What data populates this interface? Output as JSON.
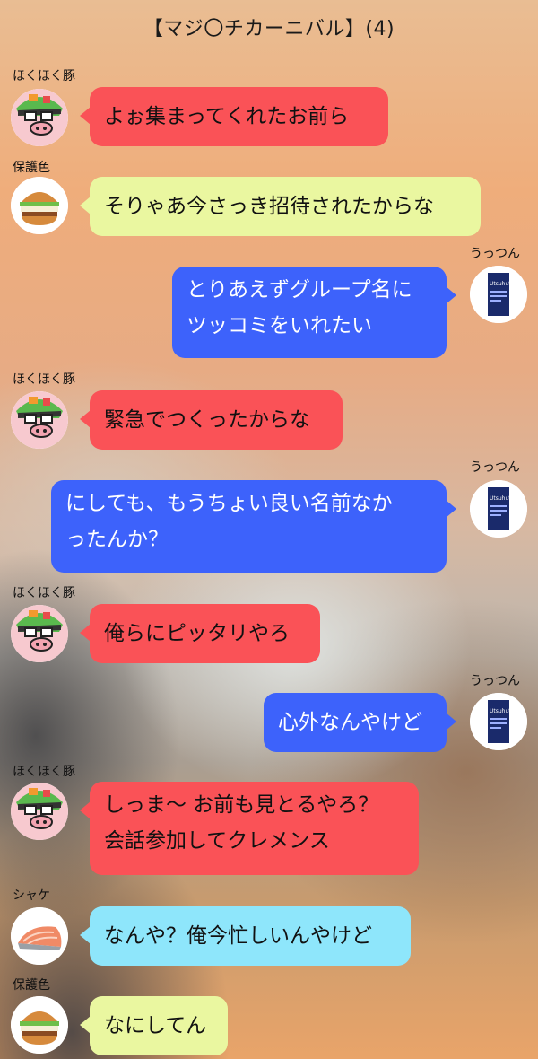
{
  "header": {
    "title": "【マジ〇チカーニバル】(4)"
  },
  "users": {
    "pig": {
      "name": "ほくほく豚",
      "avatar": "pig-avatar-icon"
    },
    "burger": {
      "name": "保護色",
      "avatar": "burger-avatar-icon"
    },
    "book": {
      "name": "うっつん",
      "avatar": "book-cover-avatar-icon"
    },
    "salmon": {
      "name": "シャケ",
      "avatar": "salmon-avatar-icon"
    }
  },
  "messages": [
    {
      "sender": "ほくほく豚",
      "text": "よぉ集まってくれたお前ら",
      "color": "#fa5257",
      "side": "left"
    },
    {
      "sender": "保護色",
      "text": "そりゃあ今さっき招待されたからな",
      "color": "#eaf7a0",
      "side": "left"
    },
    {
      "sender": "うっつん",
      "lines": [
        "とりあえずグループ名に",
        "ツッコミをいれたい"
      ],
      "color": "#3d62fb",
      "side": "right"
    },
    {
      "sender": "ほくほく豚",
      "text": "緊急でつくったからな",
      "color": "#fa5257",
      "side": "left"
    },
    {
      "sender": "うっつん",
      "lines": [
        "にしても、もうちょい良い名前なか",
        "ったんか？"
      ],
      "color": "#3d62fb",
      "side": "right"
    },
    {
      "sender": "ほくほく豚",
      "text": "俺らにピッタリやろ",
      "color": "#fa5257",
      "side": "left"
    },
    {
      "sender": "うっつん",
      "text": "心外なんやけど",
      "color": "#3d62fb",
      "side": "right"
    },
    {
      "sender": "ほくほく豚",
      "lines": [
        "しっま〜 お前も見とるやろ？",
        "会話参加してクレメンス"
      ],
      "color": "#fa5257",
      "side": "left"
    },
    {
      "sender": "シャケ",
      "text": "なんや？俺今忙しいんやけど",
      "color": "#8ee6fb",
      "side": "left"
    },
    {
      "sender": "保護色",
      "text": "なにしてん",
      "color": "#eaf7a0",
      "side": "left"
    }
  ],
  "book_cover": {
    "brand": "Utsuhuton"
  }
}
